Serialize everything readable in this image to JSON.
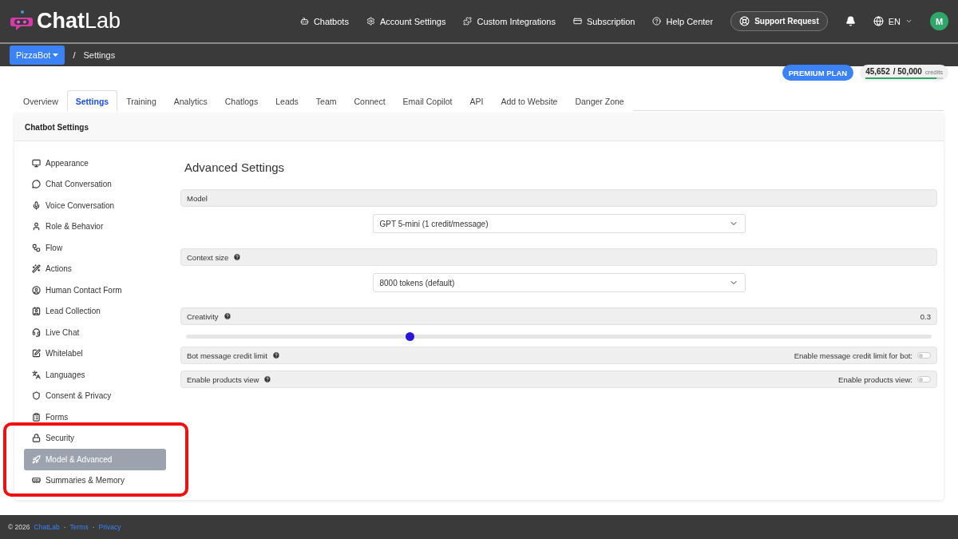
{
  "brand": {
    "name_bold": "Chat",
    "name_light": "Lab"
  },
  "nav": [
    {
      "label": "Chatbots"
    },
    {
      "label": "Account Settings"
    },
    {
      "label": "Custom Integrations"
    },
    {
      "label": "Subscription"
    },
    {
      "label": "Help Center"
    }
  ],
  "support_button": "Support Request",
  "language": "EN",
  "avatar": "M",
  "breadcrumb": {
    "bot": "PizzaBot",
    "separator": "/",
    "page": "Settings"
  },
  "plan": {
    "label": "PREMIUM PLAN",
    "used": "45,652",
    "total": "/ 50,000",
    "unit": "credits",
    "level": 0.913
  },
  "tabs": [
    {
      "label": "Overview",
      "selected": false
    },
    {
      "label": "Settings",
      "selected": true
    },
    {
      "label": "Training",
      "selected": false
    },
    {
      "label": "Analytics",
      "selected": false
    },
    {
      "label": "Chatlogs",
      "selected": false
    },
    {
      "label": "Leads",
      "selected": false
    },
    {
      "label": "Team",
      "selected": false
    },
    {
      "label": "Connect",
      "selected": false
    },
    {
      "label": "Email Copilot",
      "selected": false
    },
    {
      "label": "API",
      "selected": false
    },
    {
      "label": "Add to Website",
      "selected": false
    },
    {
      "label": "Danger Zone",
      "selected": false
    }
  ],
  "card_title": "Chatbot Settings",
  "sidebar": {
    "items": [
      {
        "label": "Appearance",
        "selected": false,
        "highlighted": false
      },
      {
        "label": "Chat Conversation",
        "selected": false,
        "highlighted": false
      },
      {
        "label": "Voice Conversation",
        "selected": false,
        "highlighted": false
      },
      {
        "label": "Role & Behavior",
        "selected": false,
        "highlighted": false
      },
      {
        "label": "Flow",
        "selected": false,
        "highlighted": false
      },
      {
        "label": "Actions",
        "selected": false,
        "highlighted": false
      },
      {
        "label": "Human Contact Form",
        "selected": false,
        "highlighted": false
      },
      {
        "label": "Lead Collection",
        "selected": false,
        "highlighted": false
      },
      {
        "label": "Live Chat",
        "selected": false,
        "highlighted": false
      },
      {
        "label": "Whitelabel",
        "selected": false,
        "highlighted": false
      },
      {
        "label": "Languages",
        "selected": false,
        "highlighted": false
      },
      {
        "label": "Consent & Privacy",
        "selected": false,
        "highlighted": false
      },
      {
        "label": "Forms",
        "selected": false,
        "highlighted": false
      },
      {
        "label": "Security",
        "selected": false,
        "highlighted": true
      },
      {
        "label": "Model & Advanced",
        "selected": true,
        "highlighted": true
      },
      {
        "label": "Summaries & Memory",
        "selected": false,
        "highlighted": true
      }
    ]
  },
  "heading": "Advanced Settings",
  "sections": [
    {
      "kind": "select",
      "label": "Model",
      "help": false,
      "value": "GPT 5-mini (1 credit/message)"
    },
    {
      "kind": "select",
      "label": "Context size",
      "help": true,
      "value": "8000 tokens (default)"
    },
    {
      "kind": "slider",
      "label": "Creativity",
      "help": true,
      "reading": "0.3",
      "level": 0.3
    },
    {
      "kind": "toggle",
      "label": "Bot message credit limit",
      "help": true,
      "toggle_label": "Enable message credit limit for bot:",
      "on": false
    },
    {
      "kind": "toggle",
      "label": "Enable products view",
      "help": true,
      "toggle_label": "Enable products view:",
      "on": false
    }
  ],
  "footer": {
    "copyright": "© 2026",
    "brand": "ChatLab",
    "dot": "·",
    "links": [
      "Terms",
      "Privacy"
    ]
  }
}
